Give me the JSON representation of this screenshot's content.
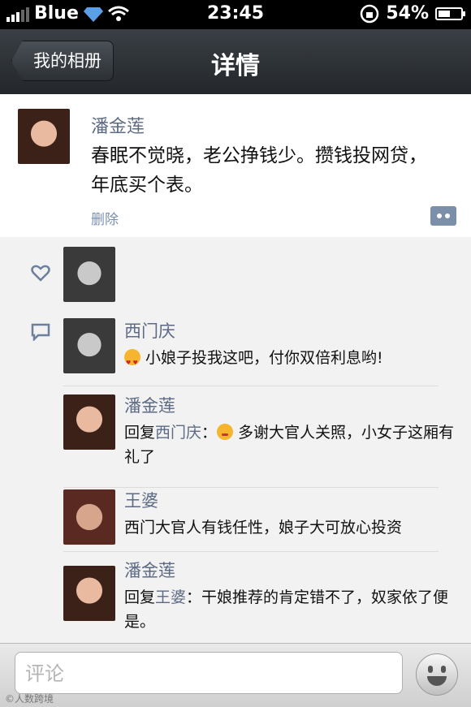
{
  "status_bar": {
    "carrier": "Blue",
    "time": "23:45",
    "battery": "54%",
    "battery_level": 0.54
  },
  "nav": {
    "back_label": "我的相册",
    "title": "详情"
  },
  "post": {
    "author": "潘金莲",
    "content": "春眠不觉晓，老公挣钱少。攒钱投网贷，年底买个表。",
    "delete_label": "删除"
  },
  "comments": [
    {
      "author": "西门庆",
      "text": "小娘子投我这吧，付你双倍利息哟!",
      "reply_prefix": "",
      "reply_to": "",
      "reply_sep": "",
      "emoji": "heart-eyes-emoji"
    },
    {
      "author": "潘金莲",
      "reply_prefix": "回复",
      "reply_to": "西门庆",
      "reply_sep": "：",
      "text": "多谢大官人关照，小女子这厢有礼了",
      "emoji": "shy-emoji"
    },
    {
      "author": "王婆",
      "text": "西门大官人有钱任性，娘子大可放心投资",
      "reply_prefix": "",
      "reply_to": "",
      "reply_sep": ""
    },
    {
      "author": "潘金莲",
      "reply_prefix": "回复",
      "reply_to": "王婆",
      "reply_sep": "：",
      "text": "干娘推荐的肯定错不了，奴家依了便是。"
    }
  ],
  "input": {
    "placeholder": "评论"
  },
  "watermark": "©人数跨境",
  "icons": {
    "like": "heart-icon",
    "comment": "chat-bubble-icon",
    "emoji_button": "smiley-icon"
  },
  "colors": {
    "name": "#5d6a85",
    "navbar": "#2c3035",
    "comments_bg": "#f2f2f2"
  }
}
